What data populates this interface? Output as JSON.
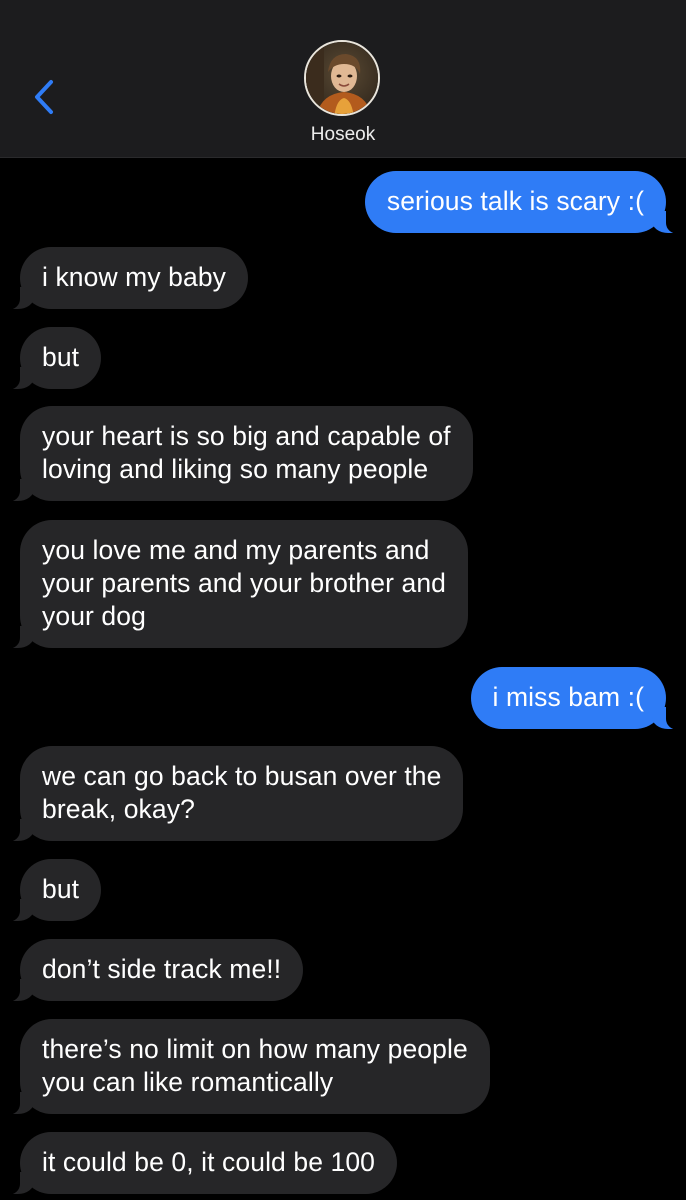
{
  "header": {
    "contact_name": "Hoseok",
    "back_icon": "chevron-left-icon",
    "accent_color": "#2f7cf6"
  },
  "messages": [
    {
      "from": "me",
      "text": "serious talk is scary :("
    },
    {
      "from": "them",
      "text": "i know my baby"
    },
    {
      "from": "them",
      "text": "but"
    },
    {
      "from": "them",
      "text": "your heart is so big and capable of\nloving and liking so many people"
    },
    {
      "from": "them",
      "text": "you love me and my parents and\nyour parents and your brother and\nyour dog"
    },
    {
      "from": "me",
      "text": "i miss bam :("
    },
    {
      "from": "them",
      "text": "we can go back to busan over the\nbreak, okay?"
    },
    {
      "from": "them",
      "text": "but"
    },
    {
      "from": "them",
      "text": "don’t side track me!!"
    },
    {
      "from": "them",
      "text": "there’s no limit on how many people\nyou can like romantically"
    },
    {
      "from": "them",
      "text": "it could be 0, it could be 100"
    }
  ],
  "colors": {
    "incoming_bubble": "#262628",
    "outgoing_bubble": "#2f7cf6",
    "header_bg": "#1c1c1e"
  }
}
